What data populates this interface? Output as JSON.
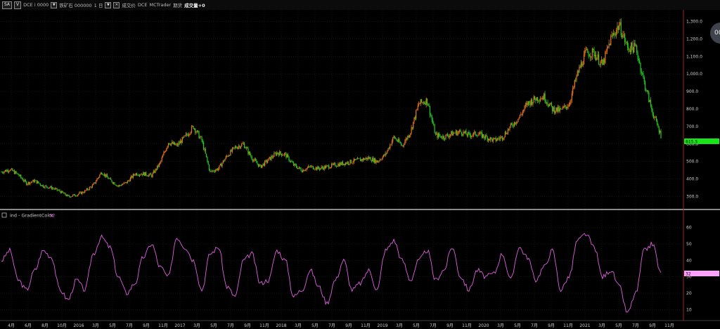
{
  "toolbar": {
    "symbol_btn": "SA",
    "mode_btn": "V",
    "exchange_code": "DCE i 0000",
    "product": "铁矿石 000000",
    "interval": "1 日",
    "price_type": "成交价",
    "exchange": "DCE",
    "vendor": "MCTrader",
    "asset": "期货",
    "volume_label": "成交量+0"
  },
  "float_button": "00",
  "price_axis": {
    "ticks": [
      "300.0",
      "400.0",
      "500.0",
      "600.0",
      "700.0",
      "800.0",
      "900.0",
      "1,000.0",
      "1,100.0",
      "1,200.0",
      "1,300.0"
    ],
    "last_price": "615.5",
    "last_color": "#19e619"
  },
  "indicator": {
    "title": "ind - GradientColor",
    "value": "32",
    "line_color": "#e060e0",
    "ticks": [
      "10",
      "20",
      "30",
      "40",
      "50",
      "60"
    ],
    "last_value": "32"
  },
  "date_axis": {
    "labels": [
      "4月",
      "6月",
      "8月",
      "10月",
      "2016",
      "3月",
      "5月",
      "7月",
      "9月",
      "11月",
      "2017",
      "3月",
      "5月",
      "7月",
      "9月",
      "11月",
      "2018",
      "3月",
      "5月",
      "7月",
      "9月",
      "11月",
      "2019",
      "3月",
      "5月",
      "7月",
      "9月",
      "11月",
      "2020",
      "3月",
      "5月",
      "7月",
      "9月",
      "11月",
      "2021",
      "3月",
      "5月",
      "7月",
      "9月",
      "11月"
    ]
  },
  "colors": {
    "up": "#e8731c",
    "down": "#22cc22",
    "grid": "#2a2a2a",
    "separator": "#dddddd",
    "axis_border": "#a02020"
  },
  "chart_data": [
    {
      "type": "candlestick",
      "title": "",
      "series": [
        {
          "x": [
            "2015-03",
            "2015-04",
            "2015-05",
            "2015-06",
            "2015-07",
            "2015-08",
            "2015-09",
            "2015-10",
            "2015-11",
            "2015-12",
            "2016-01",
            "2016-02",
            "2016-03",
            "2016-04",
            "2016-05",
            "2016-06",
            "2016-07",
            "2016-08",
            "2016-09",
            "2016-10",
            "2016-11",
            "2016-12",
            "2017-01",
            "2017-02",
            "2017-03",
            "2017-04",
            "2017-05",
            "2017-06",
            "2017-07",
            "2017-08",
            "2017-09",
            "2017-10",
            "2017-11",
            "2017-12",
            "2018-01",
            "2018-02",
            "2018-03",
            "2018-04",
            "2018-05",
            "2018-06",
            "2018-07",
            "2018-08",
            "2018-09",
            "2018-10",
            "2018-11",
            "2018-12",
            "2019-01",
            "2019-02",
            "2019-03",
            "2019-04",
            "2019-05",
            "2019-06",
            "2019-07",
            "2019-08",
            "2019-09",
            "2019-10",
            "2019-11",
            "2019-12",
            "2020-01",
            "2020-02",
            "2020-03",
            "2020-04",
            "2020-05",
            "2020-06",
            "2020-07",
            "2020-08",
            "2020-09",
            "2020-10",
            "2020-11",
            "2020-12",
            "2021-01",
            "2021-02",
            "2021-03",
            "2021-04",
            "2021-05",
            "2021-06",
            "2021-07",
            "2021-08",
            "2021-09",
            "2021-10"
          ],
          "values": [
            440,
            455,
            425,
            375,
            390,
            360,
            350,
            330,
            300,
            310,
            330,
            365,
            440,
            395,
            360,
            380,
            430,
            430,
            420,
            490,
            610,
            590,
            640,
            700,
            620,
            440,
            460,
            530,
            580,
            600,
            520,
            470,
            510,
            550,
            540,
            480,
            450,
            470,
            460,
            470,
            480,
            490,
            500,
            510,
            520,
            500,
            540,
            640,
            590,
            670,
            830,
            850,
            650,
            640,
            660,
            670,
            650,
            660,
            640,
            620,
            640,
            700,
            750,
            830,
            860,
            870,
            800,
            790,
            830,
            1000,
            1120,
            1120,
            1050,
            1200,
            1280,
            1150,
            1150,
            950,
            780,
            650
          ]
        }
      ],
      "ylim": [
        250,
        1350
      ]
    },
    {
      "type": "line",
      "title": "ind - GradientColor",
      "series": [
        {
          "name": "ind - GradientColor",
          "values": [
            40,
            46,
            28,
            22,
            34,
            46,
            42,
            22,
            16,
            28,
            22,
            44,
            54,
            48,
            30,
            20,
            26,
            42,
            50,
            36,
            30,
            54,
            48,
            40,
            22,
            44,
            48,
            24,
            18,
            40,
            44,
            26,
            28,
            46,
            40,
            18,
            22,
            34,
            24,
            14,
            28,
            40,
            22,
            26,
            34,
            22,
            46,
            52,
            40,
            28,
            40,
            46,
            28,
            34,
            48,
            30,
            22,
            34,
            30,
            32,
            44,
            28,
            48,
            42,
            28,
            36,
            46,
            22,
            30,
            52,
            56,
            48,
            30,
            34,
            24,
            8,
            20,
            46,
            50,
            32
          ]
        }
      ],
      "ylim": [
        5,
        65
      ]
    }
  ]
}
